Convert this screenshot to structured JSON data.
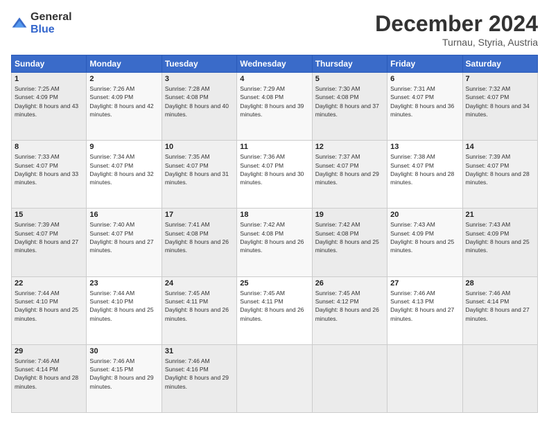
{
  "logo": {
    "general": "General",
    "blue": "Blue"
  },
  "header": {
    "month": "December 2024",
    "location": "Turnau, Styria, Austria"
  },
  "weekdays": [
    "Sunday",
    "Monday",
    "Tuesday",
    "Wednesday",
    "Thursday",
    "Friday",
    "Saturday"
  ],
  "weeks": [
    [
      {
        "day": 1,
        "sunrise": "7:25 AM",
        "sunset": "4:09 PM",
        "daylight": "8 hours and 43 minutes."
      },
      {
        "day": 2,
        "sunrise": "7:26 AM",
        "sunset": "4:09 PM",
        "daylight": "8 hours and 42 minutes."
      },
      {
        "day": 3,
        "sunrise": "7:28 AM",
        "sunset": "4:08 PM",
        "daylight": "8 hours and 40 minutes."
      },
      {
        "day": 4,
        "sunrise": "7:29 AM",
        "sunset": "4:08 PM",
        "daylight": "8 hours and 39 minutes."
      },
      {
        "day": 5,
        "sunrise": "7:30 AM",
        "sunset": "4:08 PM",
        "daylight": "8 hours and 37 minutes."
      },
      {
        "day": 6,
        "sunrise": "7:31 AM",
        "sunset": "4:07 PM",
        "daylight": "8 hours and 36 minutes."
      },
      {
        "day": 7,
        "sunrise": "7:32 AM",
        "sunset": "4:07 PM",
        "daylight": "8 hours and 34 minutes."
      }
    ],
    [
      {
        "day": 8,
        "sunrise": "7:33 AM",
        "sunset": "4:07 PM",
        "daylight": "8 hours and 33 minutes."
      },
      {
        "day": 9,
        "sunrise": "7:34 AM",
        "sunset": "4:07 PM",
        "daylight": "8 hours and 32 minutes."
      },
      {
        "day": 10,
        "sunrise": "7:35 AM",
        "sunset": "4:07 PM",
        "daylight": "8 hours and 31 minutes."
      },
      {
        "day": 11,
        "sunrise": "7:36 AM",
        "sunset": "4:07 PM",
        "daylight": "8 hours and 30 minutes."
      },
      {
        "day": 12,
        "sunrise": "7:37 AM",
        "sunset": "4:07 PM",
        "daylight": "8 hours and 29 minutes."
      },
      {
        "day": 13,
        "sunrise": "7:38 AM",
        "sunset": "4:07 PM",
        "daylight": "8 hours and 28 minutes."
      },
      {
        "day": 14,
        "sunrise": "7:39 AM",
        "sunset": "4:07 PM",
        "daylight": "8 hours and 28 minutes."
      }
    ],
    [
      {
        "day": 15,
        "sunrise": "7:39 AM",
        "sunset": "4:07 PM",
        "daylight": "8 hours and 27 minutes."
      },
      {
        "day": 16,
        "sunrise": "7:40 AM",
        "sunset": "4:07 PM",
        "daylight": "8 hours and 27 minutes."
      },
      {
        "day": 17,
        "sunrise": "7:41 AM",
        "sunset": "4:08 PM",
        "daylight": "8 hours and 26 minutes."
      },
      {
        "day": 18,
        "sunrise": "7:42 AM",
        "sunset": "4:08 PM",
        "daylight": "8 hours and 26 minutes."
      },
      {
        "day": 19,
        "sunrise": "7:42 AM",
        "sunset": "4:08 PM",
        "daylight": "8 hours and 25 minutes."
      },
      {
        "day": 20,
        "sunrise": "7:43 AM",
        "sunset": "4:09 PM",
        "daylight": "8 hours and 25 minutes."
      },
      {
        "day": 21,
        "sunrise": "7:43 AM",
        "sunset": "4:09 PM",
        "daylight": "8 hours and 25 minutes."
      }
    ],
    [
      {
        "day": 22,
        "sunrise": "7:44 AM",
        "sunset": "4:10 PM",
        "daylight": "8 hours and 25 minutes."
      },
      {
        "day": 23,
        "sunrise": "7:44 AM",
        "sunset": "4:10 PM",
        "daylight": "8 hours and 25 minutes."
      },
      {
        "day": 24,
        "sunrise": "7:45 AM",
        "sunset": "4:11 PM",
        "daylight": "8 hours and 26 minutes."
      },
      {
        "day": 25,
        "sunrise": "7:45 AM",
        "sunset": "4:11 PM",
        "daylight": "8 hours and 26 minutes."
      },
      {
        "day": 26,
        "sunrise": "7:45 AM",
        "sunset": "4:12 PM",
        "daylight": "8 hours and 26 minutes."
      },
      {
        "day": 27,
        "sunrise": "7:46 AM",
        "sunset": "4:13 PM",
        "daylight": "8 hours and 27 minutes."
      },
      {
        "day": 28,
        "sunrise": "7:46 AM",
        "sunset": "4:14 PM",
        "daylight": "8 hours and 27 minutes."
      }
    ],
    [
      {
        "day": 29,
        "sunrise": "7:46 AM",
        "sunset": "4:14 PM",
        "daylight": "8 hours and 28 minutes."
      },
      {
        "day": 30,
        "sunrise": "7:46 AM",
        "sunset": "4:15 PM",
        "daylight": "8 hours and 29 minutes."
      },
      {
        "day": 31,
        "sunrise": "7:46 AM",
        "sunset": "4:16 PM",
        "daylight": "8 hours and 29 minutes."
      },
      null,
      null,
      null,
      null
    ]
  ]
}
